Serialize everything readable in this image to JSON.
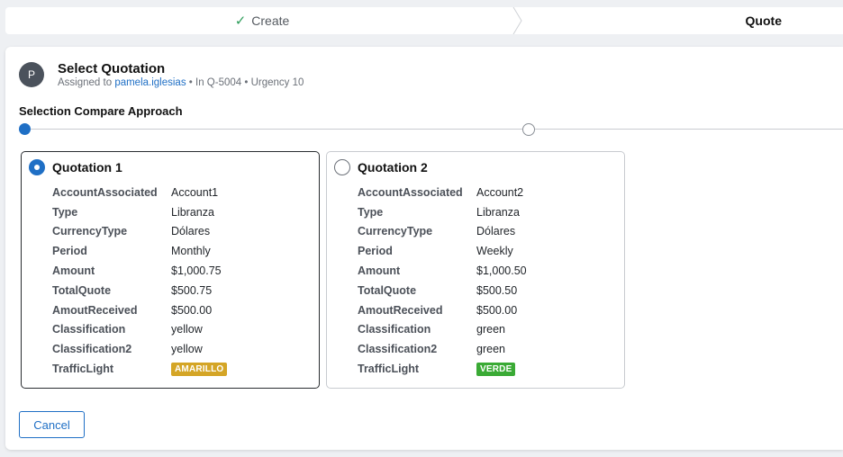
{
  "steps": {
    "create_label": "Create",
    "quote_label": "Quote"
  },
  "task": {
    "avatar_initial": "P",
    "title": "Select Quotation",
    "assigned_prefix": "Assigned to",
    "assignee": "pamela.iglesias",
    "case_ref": "In Q-5004",
    "urgency": "Urgency 10"
  },
  "approach_title": "Selection Compare Approach",
  "quotations": [
    {
      "title": "Quotation 1",
      "selected": true,
      "fields": [
        {
          "label": "AccountAssociated",
          "value": "Account1"
        },
        {
          "label": "Type",
          "value": "Libranza"
        },
        {
          "label": "CurrencyType",
          "value": "Dólares"
        },
        {
          "label": "Period",
          "value": "Monthly"
        },
        {
          "label": "Amount",
          "value": "$1,000.75"
        },
        {
          "label": "TotalQuote",
          "value": "$500.75"
        },
        {
          "label": "AmoutReceived",
          "value": "$500.00"
        },
        {
          "label": "Classification",
          "value": "yellow"
        },
        {
          "label": "Classification2",
          "value": "yellow"
        }
      ],
      "traffic_label": "TrafficLight",
      "traffic_badge": "AMARILLO",
      "traffic_color": "#d4a526"
    },
    {
      "title": "Quotation 2",
      "selected": false,
      "fields": [
        {
          "label": "AccountAssociated",
          "value": "Account2"
        },
        {
          "label": "Type",
          "value": "Libranza"
        },
        {
          "label": "CurrencyType",
          "value": "Dólares"
        },
        {
          "label": "Period",
          "value": "Weekly"
        },
        {
          "label": "Amount",
          "value": "$1,000.50"
        },
        {
          "label": "TotalQuote",
          "value": "$500.50"
        },
        {
          "label": "AmoutReceived",
          "value": "$500.00"
        },
        {
          "label": "Classification",
          "value": "green"
        },
        {
          "label": "Classification2",
          "value": "green"
        }
      ],
      "traffic_label": "TrafficLight",
      "traffic_badge": "VERDE",
      "traffic_color": "#3aaa35"
    }
  ],
  "cancel_label": "Cancel",
  "colors": {
    "accent": "#1f6fc5",
    "success_check": "#2e9e5b"
  }
}
